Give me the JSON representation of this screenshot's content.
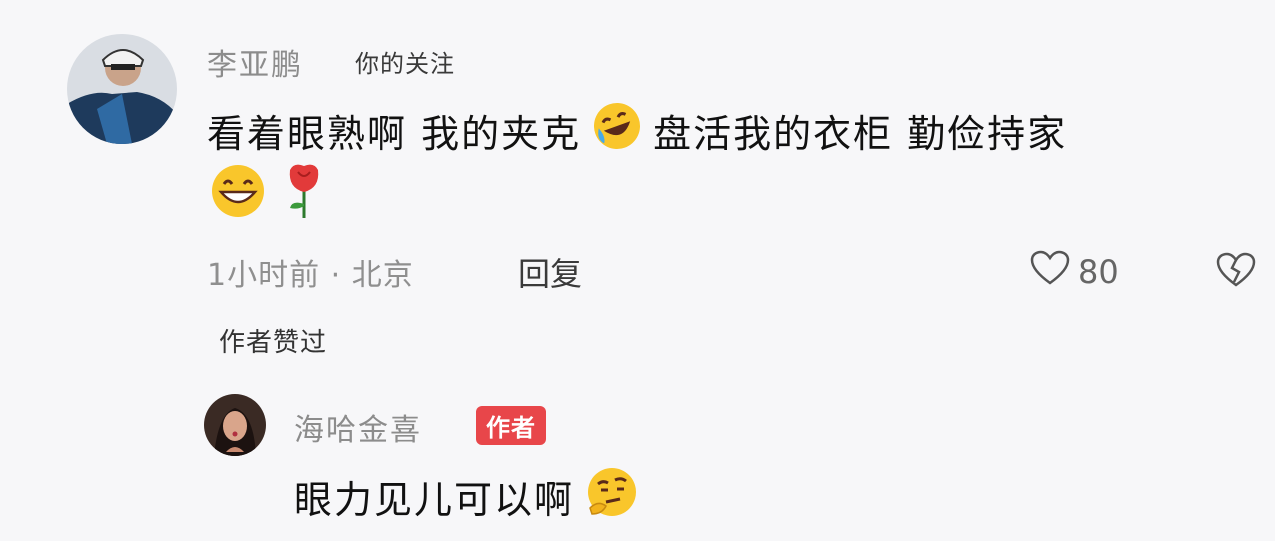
{
  "comment": {
    "username": "李亚鹏",
    "follow_label": "你的关注",
    "text_part1": "看着眼熟啊 我的夹克",
    "text_part2": "盘活我的衣柜 勤俭持家",
    "meta": "1小时前 · 北京",
    "reply_label": "回复",
    "like_count": "80",
    "author_liked": "作者赞过"
  },
  "reply": {
    "username": "海哈金喜",
    "author_tag": "作者",
    "text": "眼力见儿可以啊"
  },
  "icons": {
    "laugh_tears": "laugh-tears-emoji",
    "grin": "grin-emoji",
    "rose": "rose-emoji",
    "heart": "heart-outline-icon",
    "dislike": "broken-heart-icon",
    "think": "thinking-emoji"
  },
  "colors": {
    "author_tag_bg": "#e8464a",
    "background": "#f7f7f9"
  }
}
